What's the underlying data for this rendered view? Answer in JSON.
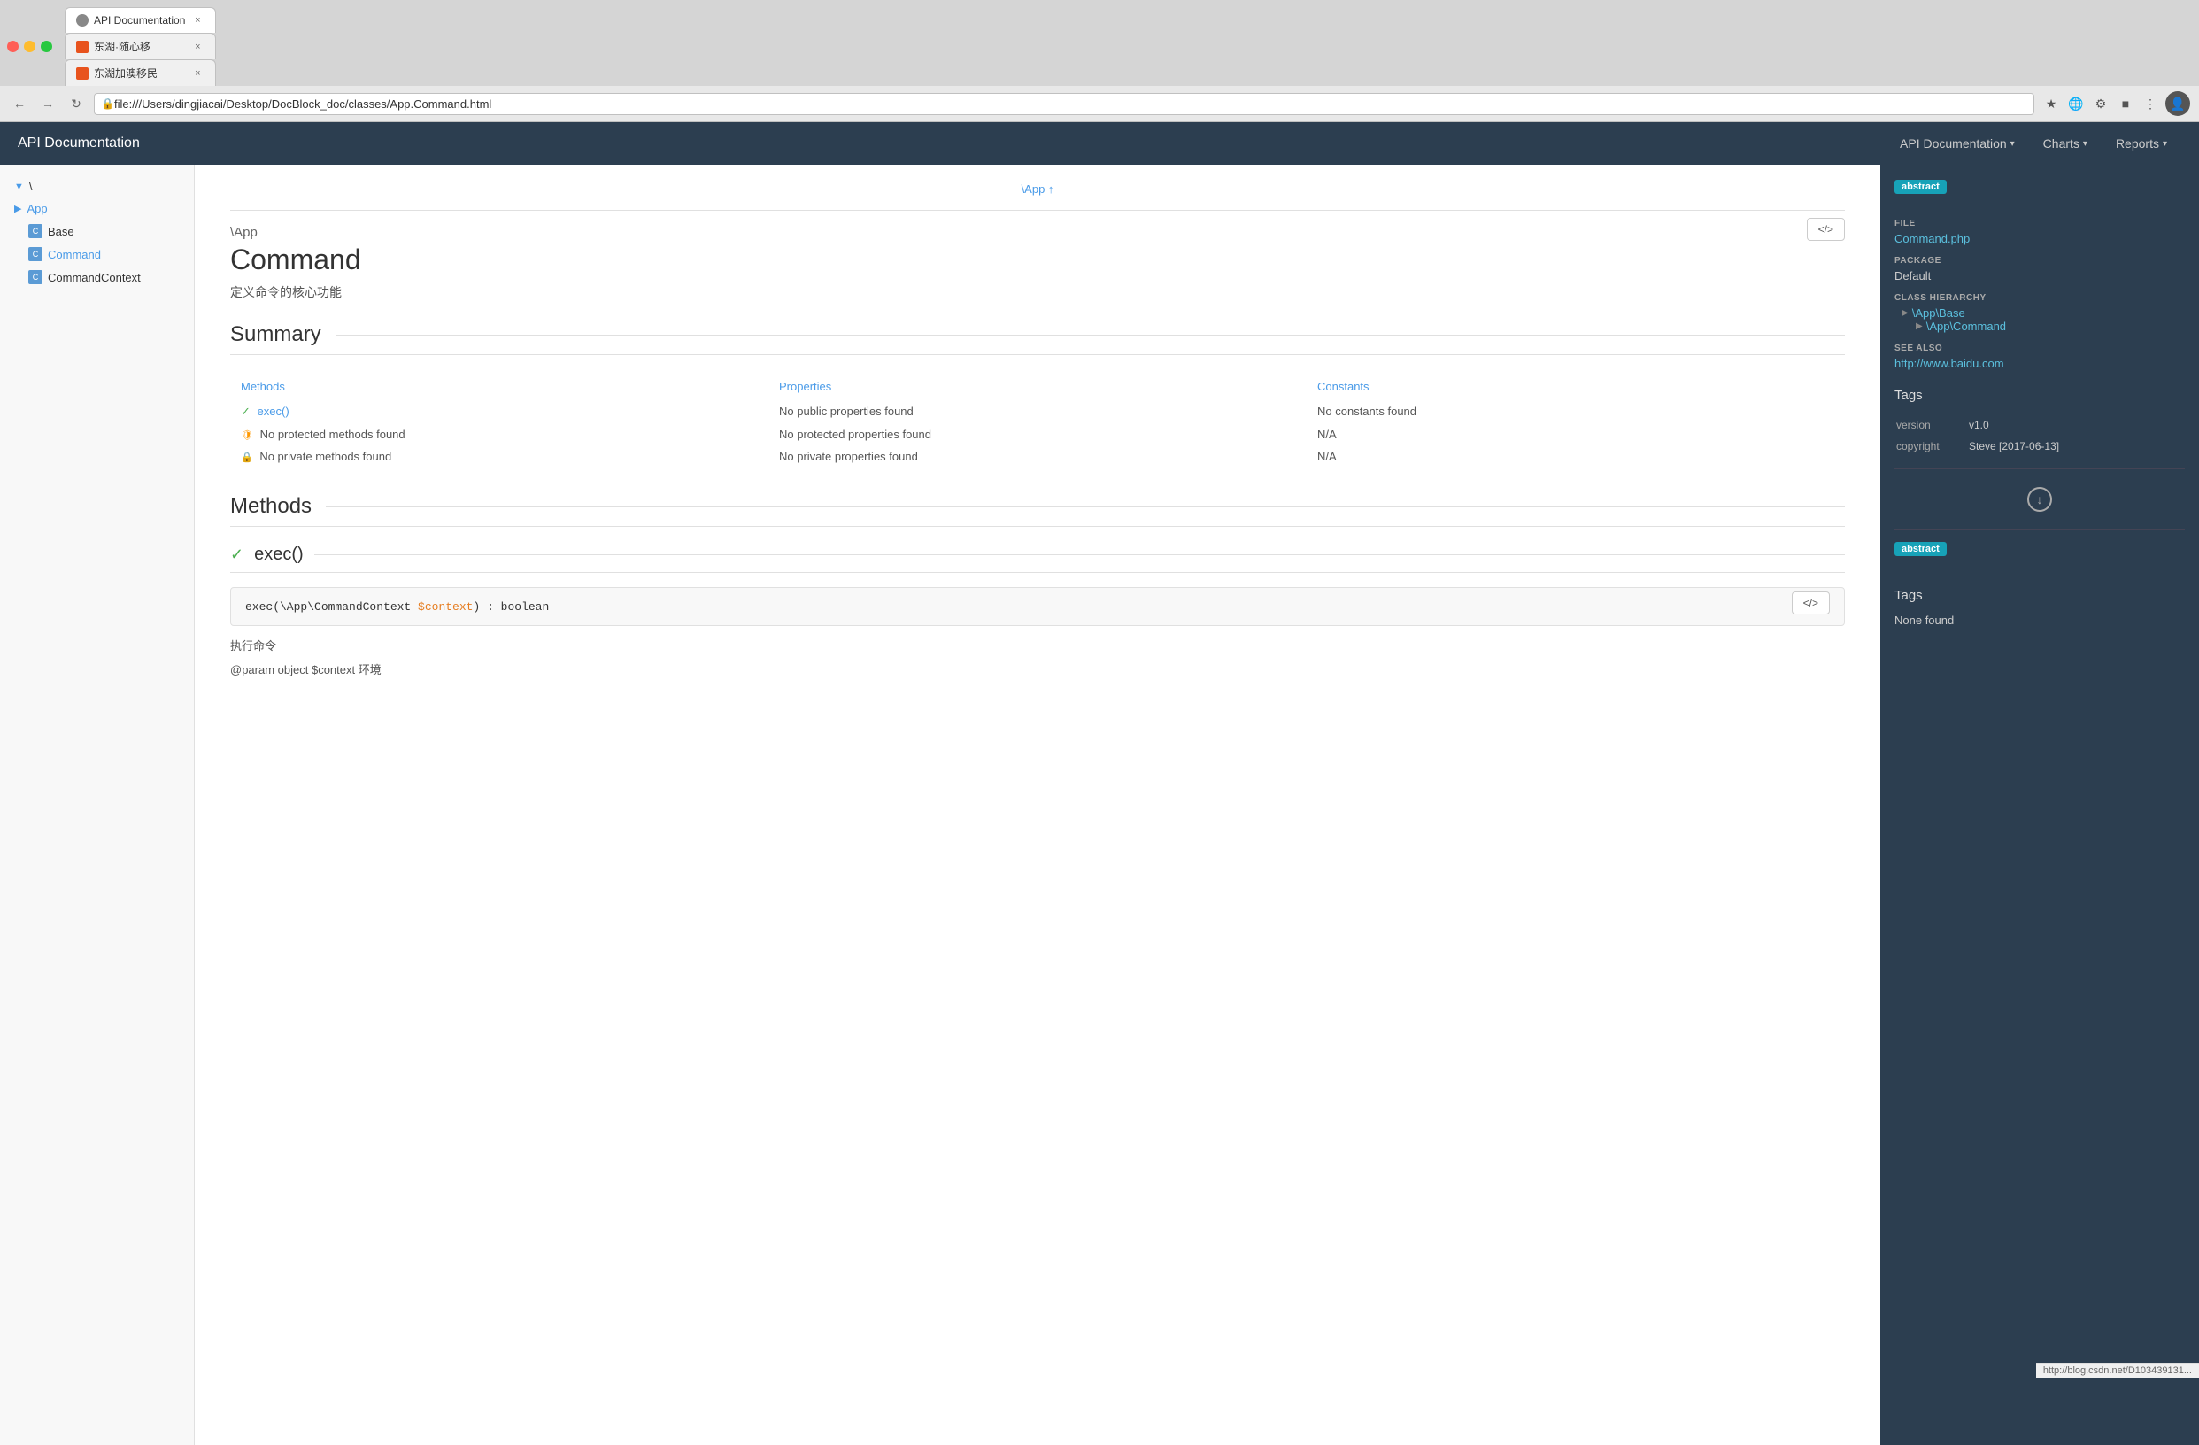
{
  "browser": {
    "tabs": [
      {
        "id": "api-doc",
        "label": "API Documentation",
        "favicon_type": "api",
        "active": true
      },
      {
        "id": "donghucai",
        "label": "东湖·随心移",
        "favicon_type": "orange",
        "active": false
      },
      {
        "id": "donghu-aus",
        "label": "东湖加澳移民",
        "favicon_type": "orange",
        "active": false
      }
    ],
    "address": "file:///Users/dingjiacai/Desktop/DocBlock_doc/classes/App.Command.html"
  },
  "header": {
    "app_title": "API Documentation",
    "nav": [
      {
        "label": "API Documentation",
        "has_dropdown": true
      },
      {
        "label": "Charts",
        "has_dropdown": true
      },
      {
        "label": "Reports",
        "has_dropdown": true
      }
    ]
  },
  "sidebar": {
    "root_label": "\\",
    "app_label": "App",
    "items": [
      {
        "label": "Base",
        "active": false
      },
      {
        "label": "Command",
        "active": true
      },
      {
        "label": "CommandContext",
        "active": false
      }
    ]
  },
  "main": {
    "breadcrumb": "\\App ↑",
    "namespace": "\\App",
    "class_name": "Command",
    "class_desc": "定义命令的核心功能",
    "source_btn": "</>",
    "summary_title": "Summary",
    "summary": {
      "methods_header": "Methods",
      "properties_header": "Properties",
      "constants_header": "Constants",
      "rows": [
        {
          "method_icon": "✔",
          "method_link": "exec()",
          "property": "No public properties found",
          "constant": "No constants found"
        },
        {
          "method_icon": "🛡",
          "method_text": "No protected methods found",
          "property": "No protected properties found",
          "constant": "N/A"
        },
        {
          "method_icon": "🔒",
          "method_text": "No private methods found",
          "property": "No private properties found",
          "constant": "N/A"
        }
      ]
    },
    "methods_title": "Methods",
    "method": {
      "name": "exec()",
      "signature_plain": "exec(\\App\\CommandContext ",
      "signature_param": "$context",
      "signature_return": ") : boolean",
      "source_btn": "</>",
      "desc": "执行命令",
      "param_label": "@param object $context 环境"
    }
  },
  "right_panel": {
    "abstract_badge": "abstract",
    "file_label": "FILE",
    "file_link": "Command.php",
    "package_label": "PACKAGE",
    "package_value": "Default",
    "hierarchy_label": "CLASS HIERARCHY",
    "hierarchy": [
      {
        "label": "\\App\\Base",
        "indent": false
      },
      {
        "label": "\\App\\Command",
        "indent": true
      }
    ],
    "see_also_label": "SEE ALSO",
    "see_also_link": "http://www.baidu.com",
    "tags_title": "Tags",
    "tags": [
      {
        "key": "version",
        "value": "v1.0"
      },
      {
        "key": "copyright",
        "value": "Steve [2017-06-13]"
      }
    ],
    "abstract_badge2": "abstract",
    "tags_title2": "Tags",
    "none_found": "None found"
  },
  "footer_url": "http://blog.csdn.net/D103439131..."
}
